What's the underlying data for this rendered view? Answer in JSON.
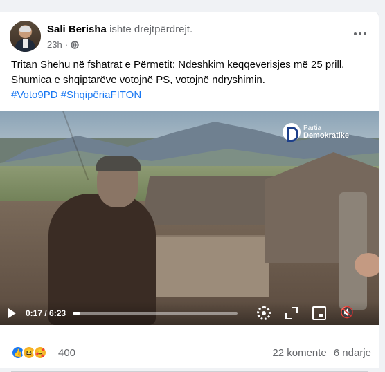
{
  "post": {
    "author": "Sali Berisha",
    "action": "ishte drejtpërdrejt.",
    "time": "23h",
    "text_line": "Tritan Shehu në fshatrat e Përmetit: Ndeshkim keqqeverisjes më 25 prill. Shumica e shqiptarëve votojnë PS, votojnë ndryshimin.",
    "hashtags": "#Voto9PD #ShqipëriaFITON"
  },
  "video": {
    "logo_line1": "Partia",
    "logo_line2": "Demokratike",
    "time_display": "0:17 / 6:23",
    "progress": 0.044,
    "controls": [
      "play-icon",
      "settings-gear-icon",
      "fullscreen-icon",
      "picture-in-picture-icon",
      "volume-mute-icon"
    ]
  },
  "footer": {
    "reactions": [
      "like-icon",
      "haha-icon",
      "care-icon"
    ],
    "reaction_count": "400",
    "comments": "22 komente",
    "shares": "6 ndarje"
  },
  "colors": {
    "link": "#1877f2",
    "text": "#050505",
    "secondary": "#65676b"
  }
}
